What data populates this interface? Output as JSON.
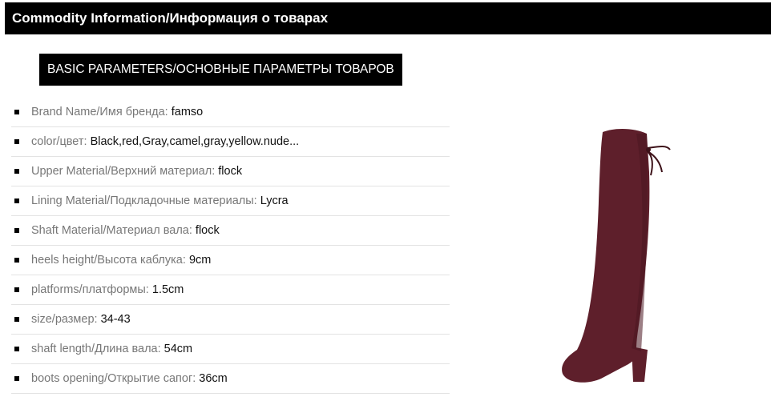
{
  "header": {
    "title": "Commodity Information/Информация о товарах"
  },
  "section": {
    "label": "BASIC PARAMETERS/ОСНОВНЫЕ ПАРАМЕТРЫ ТОВАРОВ"
  },
  "specs": [
    {
      "label": "Brand Name/Имя бренда:",
      "value": "famso"
    },
    {
      "label": "color/цвет:",
      "value": "Black,red,Gray,camel,gray,yellow.nude..."
    },
    {
      "label": "Upper Material/Верхний материал:",
      "value": "flock"
    },
    {
      "label": "Lining Material/Подкладочные материалы:",
      "value": "Lycra"
    },
    {
      "label": "Shaft Material/Материал вала:",
      "value": "flock"
    },
    {
      "label": "heels height/Высота каблука:",
      "value": "9cm"
    },
    {
      "label": "platforms/платформы:",
      "value": "1.5cm"
    },
    {
      "label": "size/размер:",
      "value": "34-43"
    },
    {
      "label": "shaft length/Длина вала:",
      "value": "54cm"
    },
    {
      "label": "boots opening/Открытие сапог:",
      "value": "36cm"
    }
  ],
  "colors": {
    "header_bg": "#000000",
    "header_text": "#ffffff",
    "boot": "#5e1f2b",
    "label_text": "#777777",
    "value_text": "#111111"
  },
  "image": {
    "subject": "over-the-knee-boot"
  }
}
